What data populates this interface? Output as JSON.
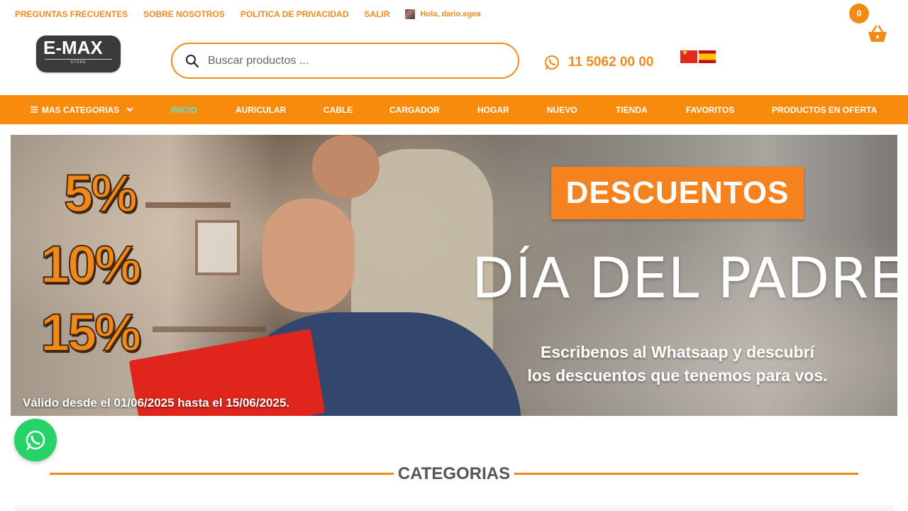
{
  "top_links": [
    "PREGUNTAS FRECUENTES",
    "SOBRE NOSOTROS",
    "POLITICA DE PRIVACIDAD",
    "SALIR"
  ],
  "user_greeting": "Hola, dario.egea",
  "cart": {
    "count": "0",
    "icon": "basket-icon"
  },
  "logo": {
    "brand": "E-MAX",
    "sub": "STORE"
  },
  "search": {
    "placeholder": "Buscar productos ...",
    "icon": "search-icon"
  },
  "phone": {
    "number": "11 5062 00 00",
    "icon": "whatsapp-icon"
  },
  "flags": [
    "china-flag",
    "spain-flag"
  ],
  "nav": {
    "categories_label": "MAS CATEGORIAS",
    "items": [
      "INICIO",
      "AURICULAR",
      "CABLE",
      "CARGADOR",
      "HOGAR",
      "NUEVO",
      "TIENDA",
      "FAVORITOS",
      "PRODUCTOS EN OFERTA"
    ],
    "active": "INICIO"
  },
  "banner": {
    "percentages": [
      "5%",
      "10%",
      "15%"
    ],
    "tag": "DESCUENTOS",
    "headline": "DÍA DEL PADRE",
    "promo_line1": "Escribenos al Whatsaap y descubrí",
    "promo_line2": "los descuentos que tenemos para vos.",
    "validity": "Válido desde el 01/06/2025 hasta el 15/06/2025."
  },
  "section": {
    "title": "CATEGORIAS"
  },
  "colors": {
    "brand_orange": "#f98b0c",
    "active_nav": "#5fe0e0",
    "whatsapp": "#25d366"
  }
}
